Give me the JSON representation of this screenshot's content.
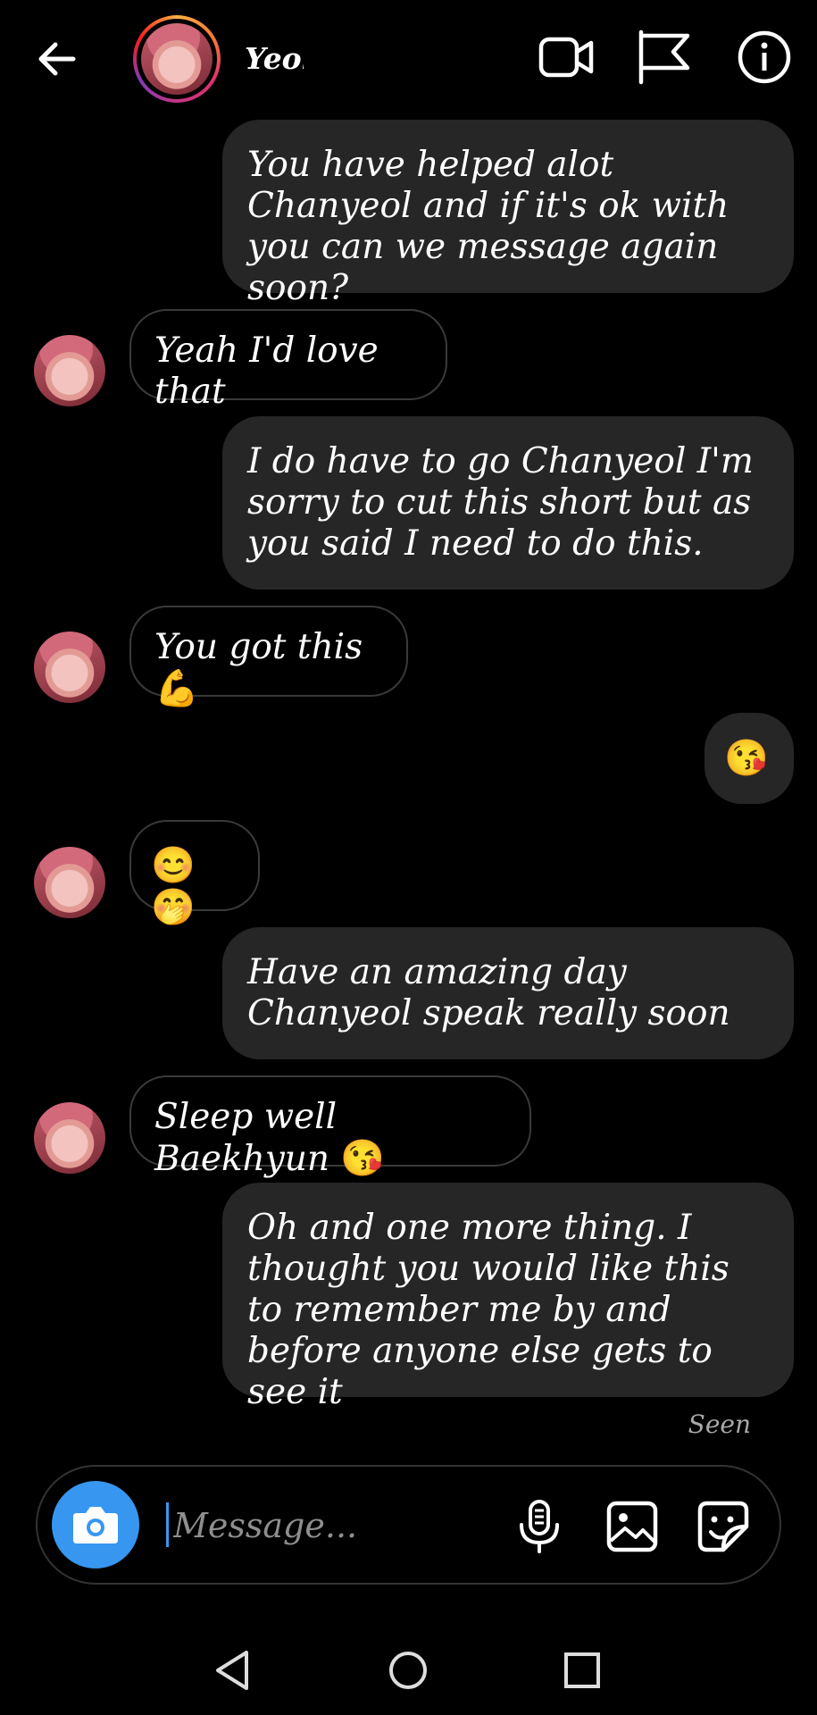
{
  "header": {
    "contact_name": "Yeol",
    "icons": [
      "back-arrow-icon",
      "video-call-icon",
      "flag-icon",
      "info-icon"
    ]
  },
  "messages": [
    {
      "dir": "out",
      "text": "You have helped alot Chanyeol and if it's ok with you can we message again soon?"
    },
    {
      "dir": "in",
      "text": "Yeah I'd love that"
    },
    {
      "dir": "out",
      "text": "I do have to go Chanyeol  I'm sorry to cut this short but as you said I need to do this."
    },
    {
      "dir": "in",
      "text": "You got this",
      "emoji": "💪"
    },
    {
      "dir": "out",
      "text": "",
      "emoji": "😘"
    },
    {
      "dir": "in",
      "text": "",
      "emoji": "😊🤭"
    },
    {
      "dir": "out",
      "text": "Have an amazing day Chanyeol speak really soon"
    },
    {
      "dir": "in",
      "text": "Sleep well Baekhyun",
      "emoji": "😘"
    },
    {
      "dir": "out",
      "text": "Oh and one more thing. I thought you would like this to remember me by and before anyone else gets to see it"
    }
  ],
  "status": {
    "seen": "Seen"
  },
  "composer": {
    "placeholder": "Message...",
    "icons": [
      "camera-icon",
      "microphone-icon",
      "gallery-icon",
      "sticker-icon"
    ]
  },
  "navbar": {
    "icons": [
      "nav-back-icon",
      "nav-home-icon",
      "nav-recents-icon"
    ]
  },
  "colors": {
    "background": "#000000",
    "bubble": "#262626",
    "accent": "#3797f0"
  }
}
